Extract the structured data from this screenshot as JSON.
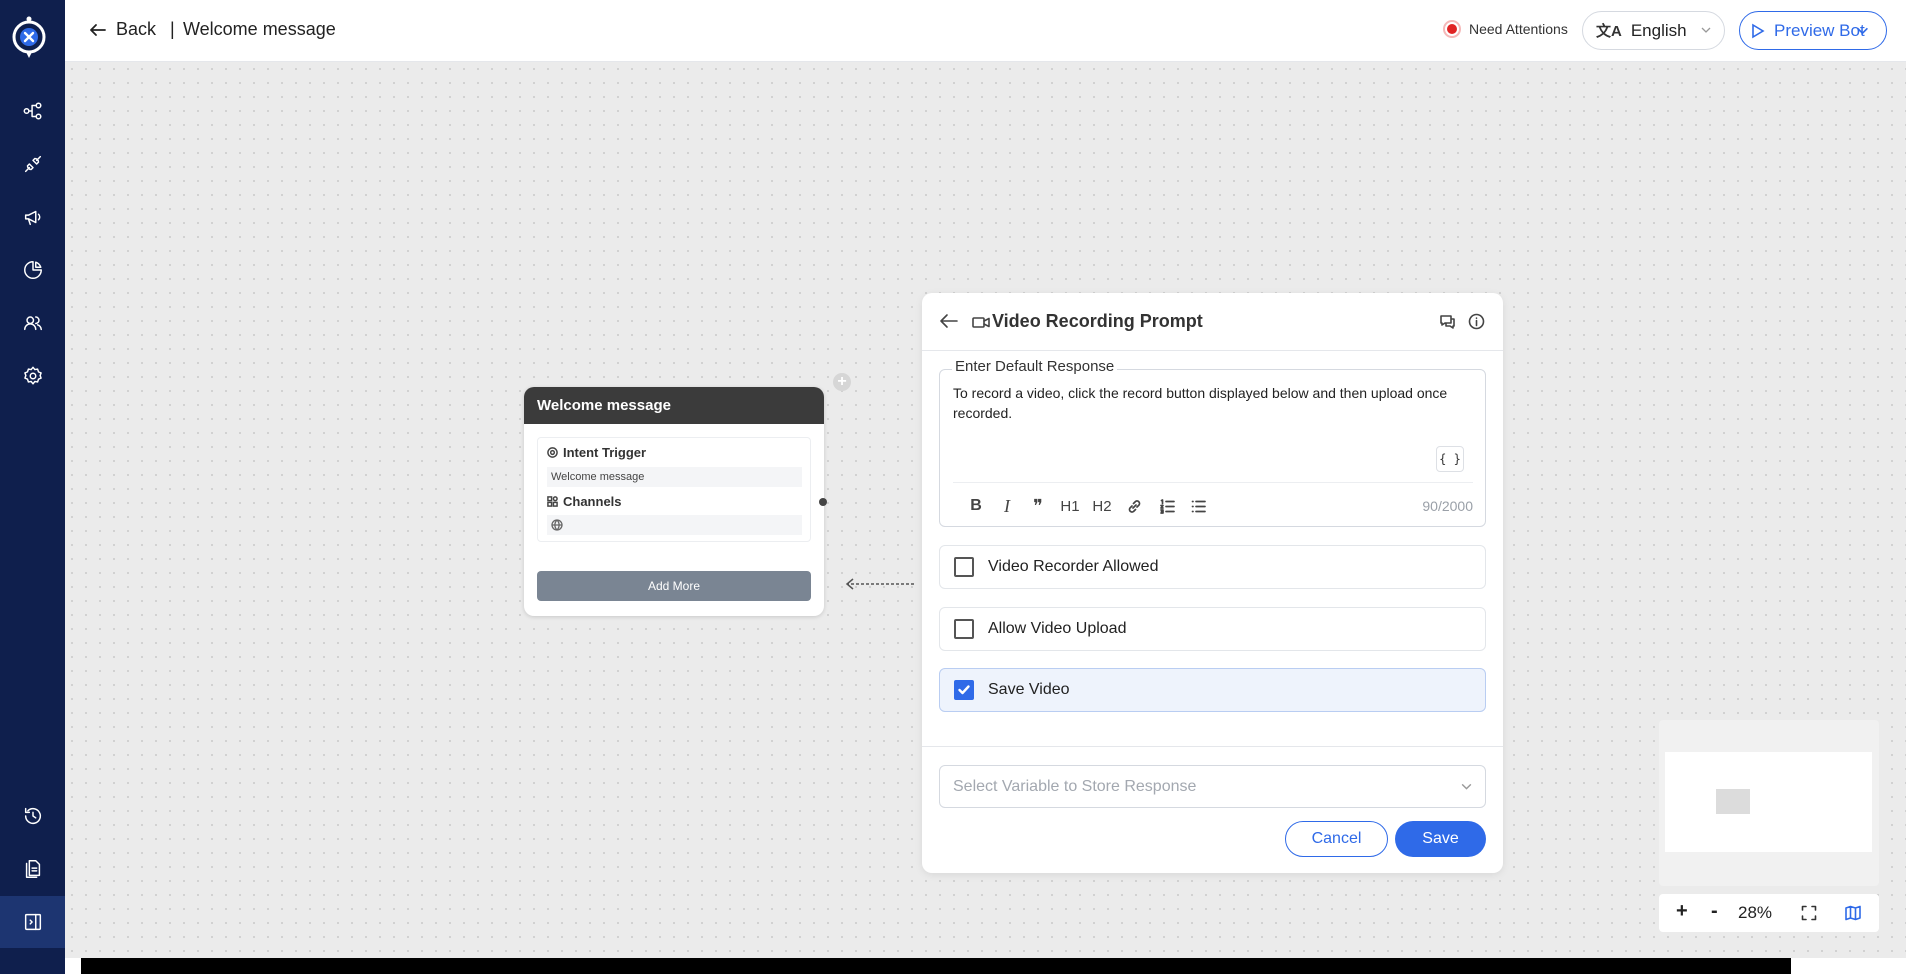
{
  "header": {
    "back_label": "Back",
    "separator": "|",
    "title": "Welcome message",
    "attention_label": "Need Attentions",
    "language_label": "English",
    "language_icon": "translate-icon",
    "preview_label": "Preview Bot"
  },
  "sidebar": {
    "top_items": [
      "flow-icon",
      "integrations-icon",
      "broadcast-icon",
      "analytics-icon",
      "users-icon",
      "settings-icon"
    ],
    "bottom_items": [
      "history-icon",
      "documents-icon",
      "collapse-panel-icon"
    ]
  },
  "node": {
    "title": "Welcome message",
    "intent_label": "Intent Trigger",
    "intent_value": "Welcome message",
    "channels_label": "Channels",
    "add_more_label": "Add More",
    "plus": "+"
  },
  "modal": {
    "title": "Video Recording Prompt",
    "response_legend": "Enter Default Response",
    "response_text": "To record a video, click the record button displayed below and then upload once recorded.",
    "variable_button": "{ }",
    "counter": "90/2000",
    "toolbar": {
      "bold": "B",
      "italic": "I",
      "quote": "❞",
      "h1": "H1",
      "h2": "H2"
    },
    "options": [
      {
        "label": "Video Recorder Allowed",
        "checked": false
      },
      {
        "label": "Allow Video Upload",
        "checked": false
      },
      {
        "label": "Save Video",
        "checked": true
      }
    ],
    "select_placeholder": "Select Variable to Store Response",
    "cancel_label": "Cancel",
    "save_label": "Save"
  },
  "zoom": {
    "plus": "+",
    "minus": "-",
    "level": "28%"
  },
  "colors": {
    "sidebar": "#0f1f4d",
    "accent": "#2f6ae8",
    "alert": "#e02424"
  }
}
